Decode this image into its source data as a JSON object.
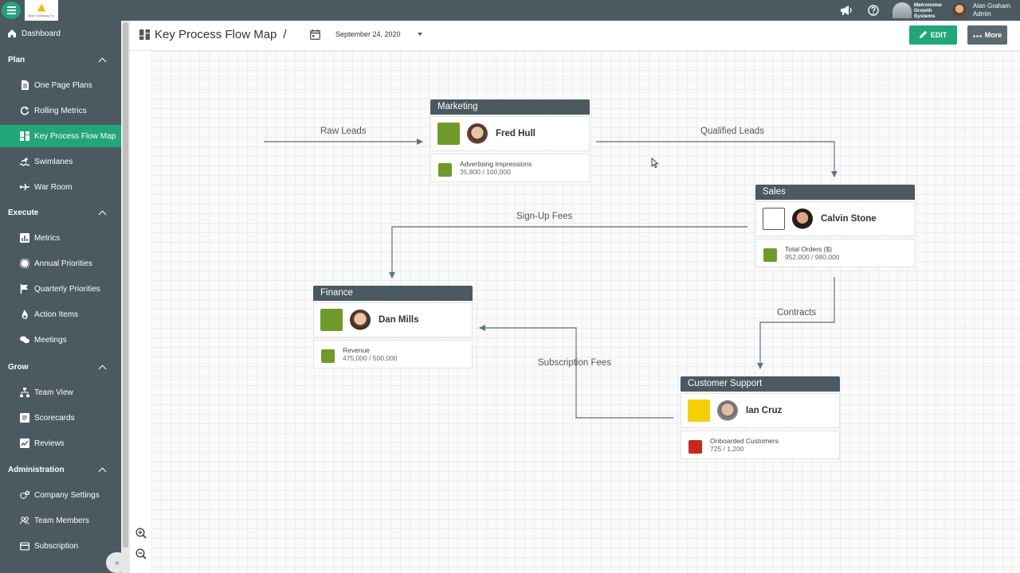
{
  "app": {
    "logo_text": "Key Clothing Co",
    "metronome_label": "Metronome Growth Systems",
    "user": {
      "name": "Alan Graham",
      "role": "Admin"
    }
  },
  "sidebar": {
    "dashboard": "Dashboard",
    "sections": [
      {
        "label": "Plan",
        "items": [
          "One Page Plans",
          "Rolling Metrics",
          "Key Process Flow Map",
          "Swimlanes",
          "War Room"
        ]
      },
      {
        "label": "Execute",
        "items": [
          "Metrics",
          "Annual Priorities",
          "Quarterly Priorities",
          "Action Items",
          "Meetings"
        ]
      },
      {
        "label": "Grow",
        "items": [
          "Team View",
          "Scorecards",
          "Reviews"
        ]
      },
      {
        "label": "Administration",
        "items": [
          "Company Settings",
          "Team Members",
          "Subscription"
        ]
      }
    ],
    "collapse_label": "«"
  },
  "header": {
    "title": "Key Process Flow Map",
    "separator": "/",
    "date": "September 24, 2020",
    "edit_label": "EDIT",
    "more_label": "More"
  },
  "flow": {
    "edges": {
      "raw_leads": "Raw Leads",
      "qualified_leads": "Qualified Leads",
      "sign_up_fees": "Sign-Up Fees",
      "contracts": "Contracts",
      "subscription_fees": "Subscription Fees"
    },
    "nodes": {
      "marketing": {
        "title": "Marketing",
        "owner": "Fred Hull",
        "metric_label": "Advertising Impressions",
        "metric_value": "35,800 / 100,000",
        "owner_status": "#6f9a2a",
        "metric_status": "#6f9a2a"
      },
      "sales": {
        "title": "Sales",
        "owner": "Calvin Stone",
        "metric_label": "Total Orders ($)",
        "metric_value": "952,000 / 980,000",
        "owner_status": "#ffffff",
        "metric_status": "#6f9a2a"
      },
      "finance": {
        "title": "Finance",
        "owner": "Dan Mills",
        "metric_label": "Revenue",
        "metric_value": "475,000 / 500,000",
        "owner_status": "#6f9a2a",
        "metric_status": "#6f9a2a"
      },
      "support": {
        "title": "Customer Support",
        "owner": "Ian Cruz",
        "metric_label": "Onboarded Customers",
        "metric_value": "725 / 1,200",
        "owner_status": "#f5d000",
        "metric_status": "#c62a1a"
      }
    }
  },
  "colors": {
    "accent": "#23a57a",
    "chrome": "#4a5a60",
    "green": "#6f9a2a",
    "yellow": "#f5d000",
    "red": "#c62a1a"
  }
}
